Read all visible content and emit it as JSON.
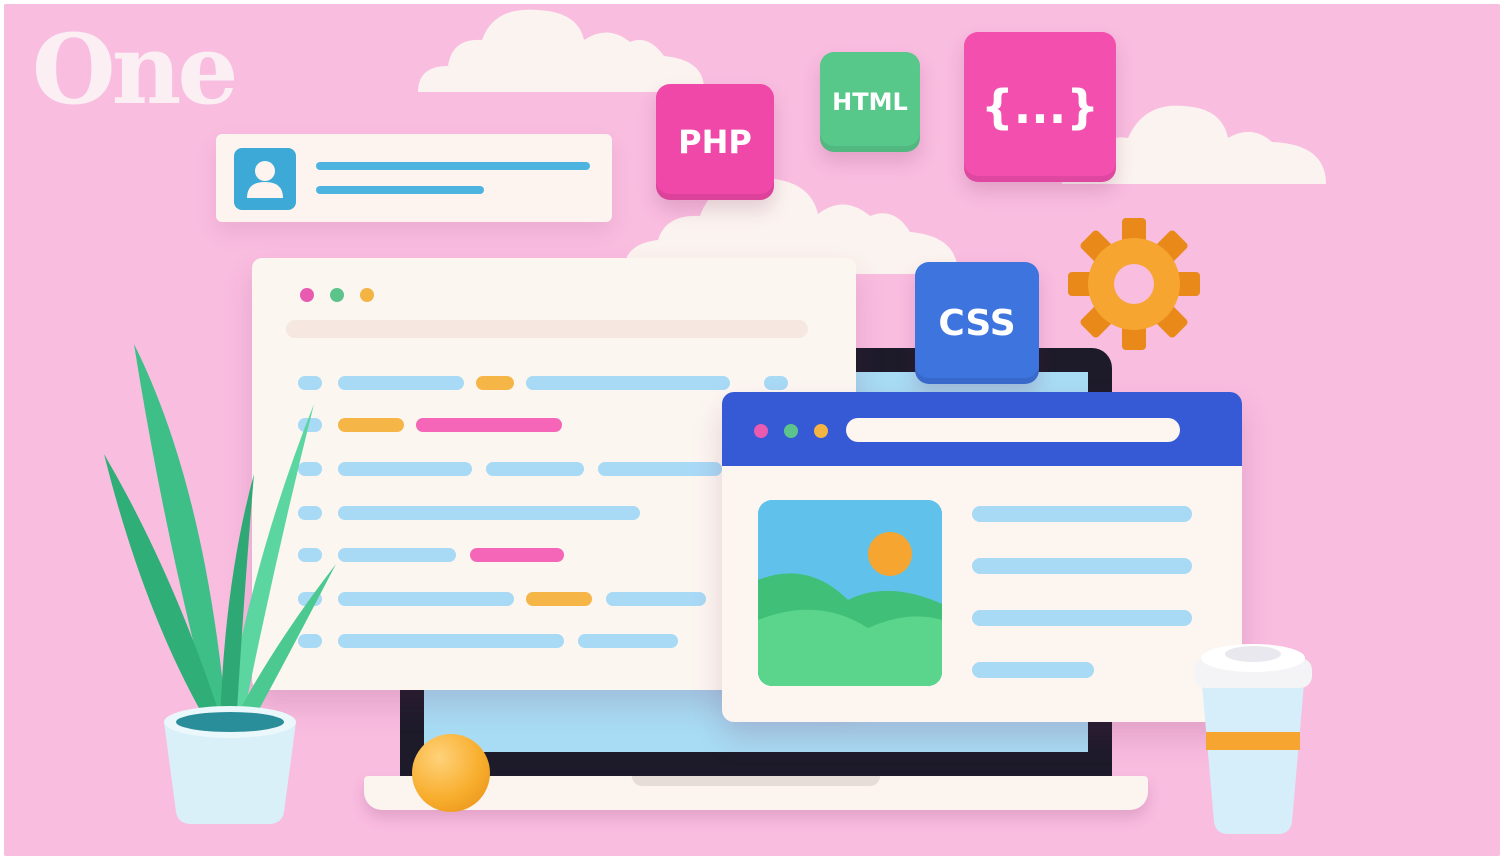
{
  "logo": {
    "text": "One"
  },
  "tags": {
    "php": "PHP",
    "html": "HTML",
    "braces": "{...}",
    "css": "CSS"
  },
  "colors": {
    "background": "#f9bde0",
    "pink": "#ef48a8",
    "green": "#58c88a",
    "blue": "#3e74dd",
    "browser_header": "#3659d5",
    "orange": "#f8ae2e",
    "light_blue": "#a8d9f5"
  },
  "icons": {
    "profile": "user-icon",
    "settings": "gear-icon",
    "image": "image-icon"
  }
}
